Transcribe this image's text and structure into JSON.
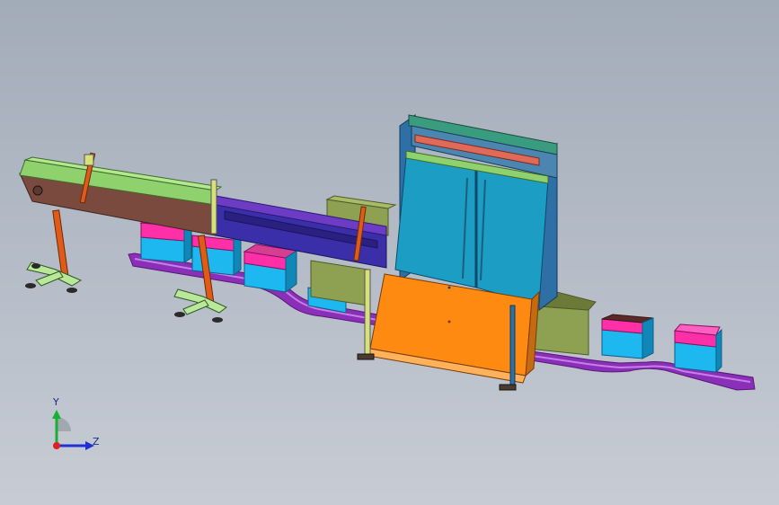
{
  "colors": {
    "background_top": "#a2acb8",
    "background_bottom": "#c7ccd4",
    "base_rail": "#8a2fb8",
    "conveyor_green": "#8fd16c",
    "conveyor_brown": "#7a4a3e",
    "conveyor_blue": "#3a2fa8",
    "machine_frame": "#2e6fa6",
    "machine_glass": "#1b9dc4",
    "machine_orange": "#ff8a12",
    "box_olive": "#8ea052",
    "box_magenta": "#ff2fa8",
    "box_cyan": "#1eb8f0",
    "leg_orange": "#e05a18",
    "foot_green": "#b9e89a"
  },
  "axis_triad": {
    "y_label": "Y",
    "z_label": "Z"
  }
}
